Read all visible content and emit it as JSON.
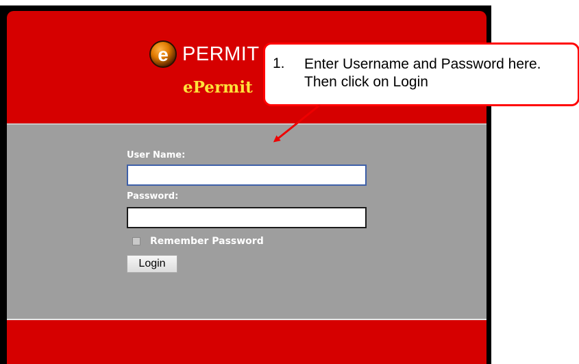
{
  "brand": {
    "logo_letter": "e",
    "logo_text": "PERMIT",
    "app_name": "ePermit"
  },
  "login_form": {
    "username_label": "User Name:",
    "username_value": "",
    "password_label": "Password:",
    "password_value": "",
    "remember_label": "Remember Password",
    "remember_checked": false,
    "login_button": "Login"
  },
  "callout": {
    "number": "1.",
    "text": "Enter Username and Password here. Then click on Login"
  },
  "colors": {
    "panel_red": "#d60000",
    "form_gray": "#9e9e9e",
    "title_yellow": "#ffe23a",
    "callout_border": "#ff0000"
  }
}
